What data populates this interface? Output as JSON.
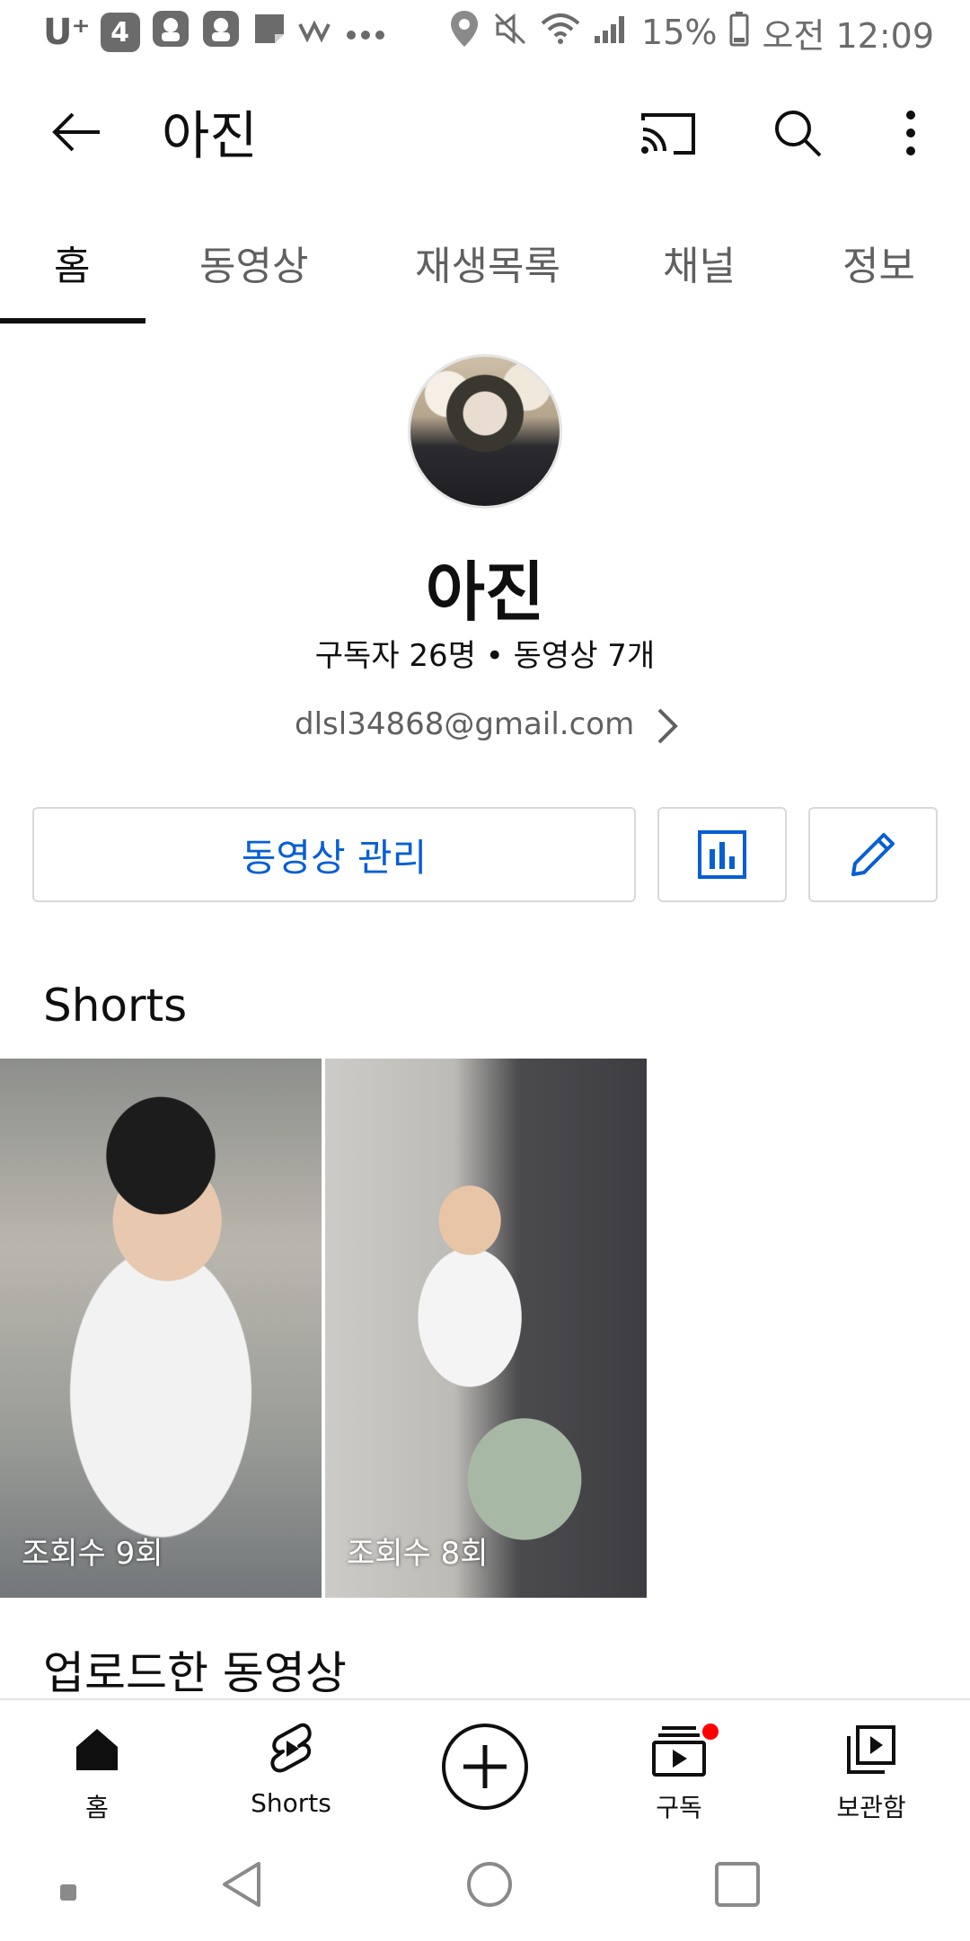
{
  "status_bar": {
    "carrier": "U⁺",
    "badge": "4",
    "battery": "15%",
    "time": "오전 12:09"
  },
  "app_bar": {
    "title": "아진",
    "icons": [
      "back-arrow-icon",
      "cast-icon",
      "search-icon",
      "more-vert-icon"
    ]
  },
  "tabs": [
    {
      "label": "홈",
      "active": true
    },
    {
      "label": "동영상"
    },
    {
      "label": "재생목록"
    },
    {
      "label": "채널"
    },
    {
      "label": "정보"
    }
  ],
  "channel": {
    "name": "아진",
    "stats": "구독자 26명 • 동영상 7개",
    "email": "dlsl34868@gmail.com"
  },
  "actions": {
    "manage_label": "동영상 관리",
    "accent": "#065fd4"
  },
  "shorts": {
    "title": "Shorts",
    "items": [
      {
        "views": "조회수 9회"
      },
      {
        "views": "조회수 8회"
      }
    ]
  },
  "uploads": {
    "title": "업로드한 동영상"
  },
  "bottom_nav": {
    "items": [
      {
        "label": "홈",
        "icon": "home-icon"
      },
      {
        "label": "Shorts",
        "icon": "shorts-icon"
      },
      {
        "label": "",
        "icon": "create-icon"
      },
      {
        "label": "구독",
        "icon": "subscriptions-icon",
        "notification": true
      },
      {
        "label": "보관함",
        "icon": "library-icon"
      }
    ]
  }
}
